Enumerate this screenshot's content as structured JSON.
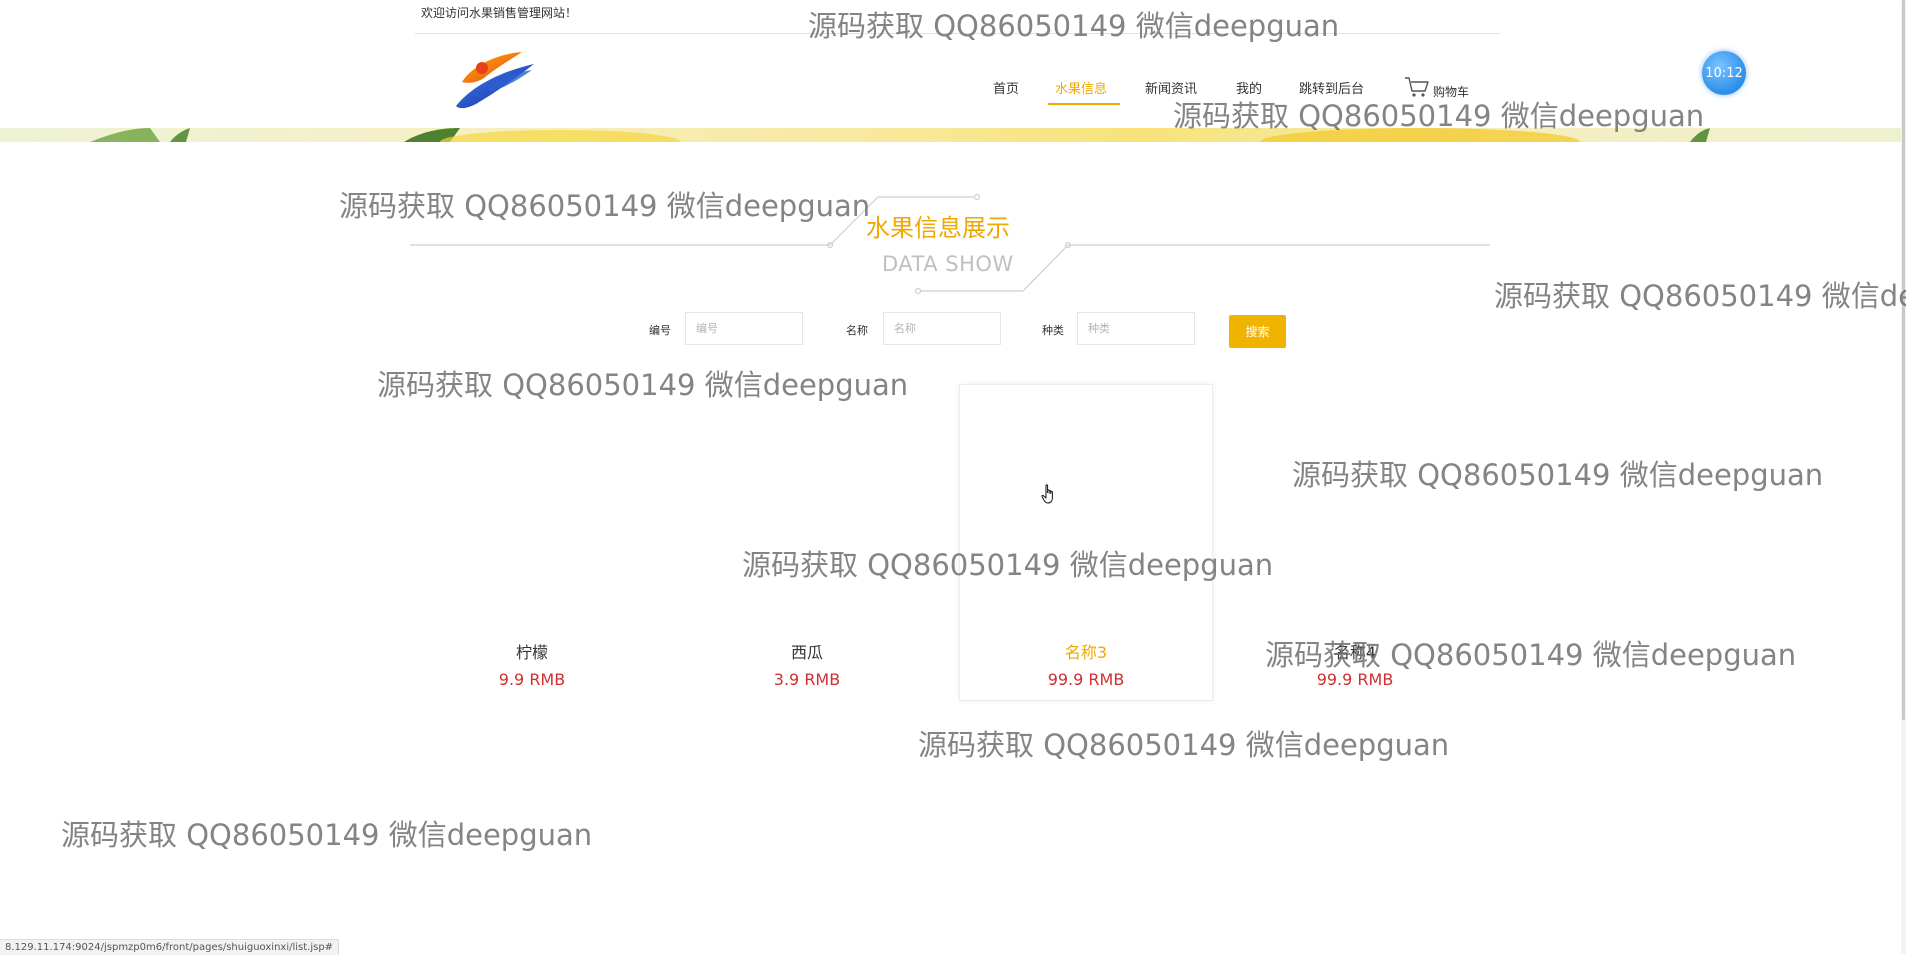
{
  "header": {
    "welcome": "欢迎访问水果销售管理网站！",
    "clock": "10:12"
  },
  "nav": {
    "items": [
      {
        "label": "首页"
      },
      {
        "label": "水果信息"
      },
      {
        "label": "新闻资讯"
      },
      {
        "label": "我的"
      },
      {
        "label": "跳转到后台"
      }
    ],
    "active_index": 1,
    "cart_label": "购物车"
  },
  "section": {
    "title": "水果信息展示",
    "subtitle": "DATA SHOW"
  },
  "search": {
    "fields": [
      {
        "label": "编号",
        "placeholder": "编号",
        "value": ""
      },
      {
        "label": "名称",
        "placeholder": "名称",
        "value": ""
      },
      {
        "label": "种类",
        "placeholder": "种类",
        "value": ""
      }
    ],
    "button_label": "搜索"
  },
  "products": [
    {
      "name": "柠檬",
      "price": "9.9 RMB"
    },
    {
      "name": "西瓜",
      "price": "3.9 RMB"
    },
    {
      "name": "名称3",
      "price": "99.9 RMB"
    },
    {
      "name": "名称4",
      "price": "99.9 RMB"
    }
  ],
  "hovered_product_index": 2,
  "status_bar": {
    "url": "8.129.11.174:9024/jspmzp0m6/front/pages/shuiguoxinxi/list.jsp#"
  },
  "watermark": "源码获取 QQ86050149 微信deepguan",
  "colors": {
    "accent": "#f0a800",
    "price": "#d0302f",
    "search_button": "#f0b400"
  }
}
